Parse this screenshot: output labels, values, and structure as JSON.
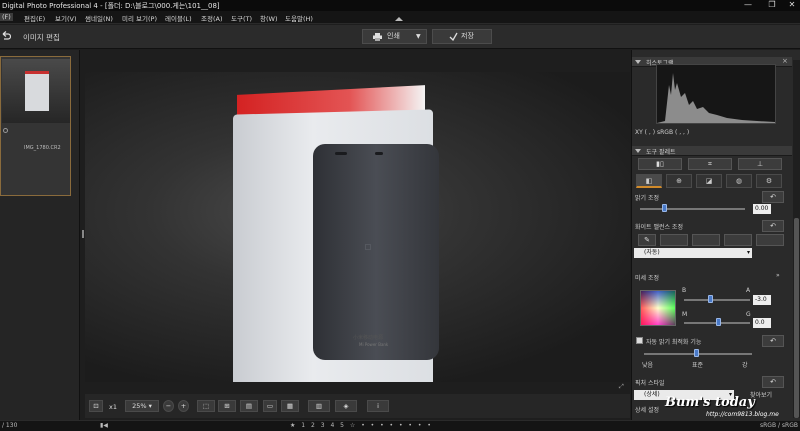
{
  "window": {
    "title": "Digital Photo Professional 4 - [폴더: D:\\블로그\\000.게는\\101__08]",
    "minimize": "—",
    "restore": "❐",
    "close": "✕"
  },
  "menu": [
    "(F)",
    "편집(E)",
    "보기(V)",
    "썸네일(N)",
    "미리 보기(P)",
    "레이블(L)",
    "조정(A)",
    "도구(T)",
    "창(W)",
    "도움말(H)"
  ],
  "toolbar": {
    "mode_label": "이미지 편집",
    "print_label": "인쇄",
    "save_label": "저장"
  },
  "thumbnail": {
    "filename": "IMG_1780.CR2"
  },
  "photo": {
    "caption_line1": "小米移动电源",
    "caption_line2": "Mi Power Bank"
  },
  "viewer_bar": {
    "zoom_x": "x1",
    "zoom_percent": "25%"
  },
  "status": {
    "count": "/ 130",
    "color_space": "sRGB / sRGB"
  },
  "panel": {
    "histogram_title": "히스토그램",
    "xy_label": "XY (   ,   )    sRGB (   ,   ,   )",
    "tool_palette_title": "도구 팔레트",
    "brightness_label": "밝기 조정",
    "brightness_value": "0.00",
    "white_balance_label": "화이트 밸런스 조정",
    "wb_select": "(자동)",
    "fine_adjust_label": "미세 조정",
    "b_label": "B",
    "a_label": "A",
    "m_label": "M",
    "g_label": "G",
    "ba_value": "-3.0",
    "mg_value": "0.0",
    "auto_brightness_label": "자동 밝기 최적화 기능",
    "auto_low": "낮음",
    "auto_std": "표준",
    "auto_high": "강",
    "picture_style_label": "픽처 스타일",
    "picture_style_select": "(상세)",
    "detail_label": "상세 설정",
    "picture_style_btn": "찾아보기",
    "sharpness_label": "샤프니스"
  },
  "watermark": {
    "line1": "Bum's today",
    "line2": "http://com9813.blog.me"
  },
  "colors": {
    "accent": "#d08a2a",
    "knob": "#4a7ac8"
  }
}
